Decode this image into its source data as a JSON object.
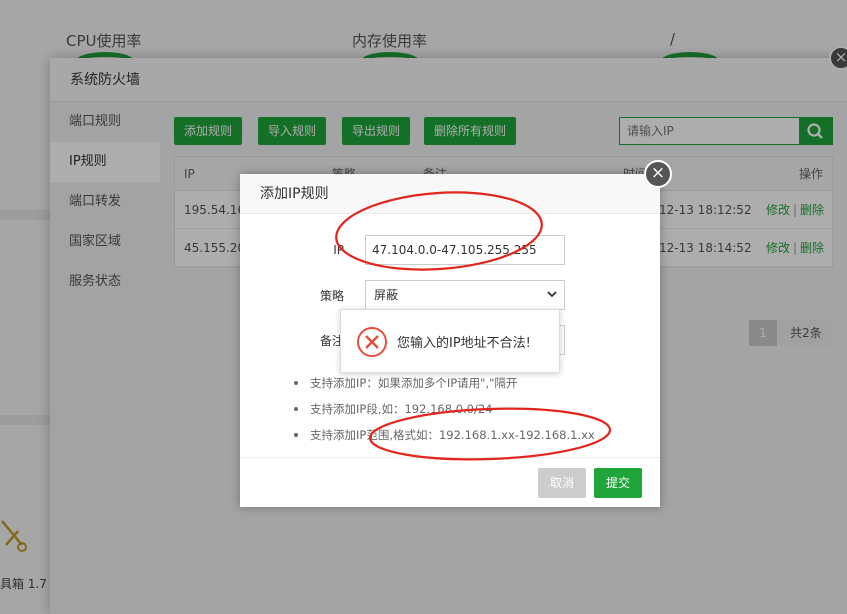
{
  "background": {
    "metrics": [
      "CPU使用率",
      "内存使用率",
      "/"
    ],
    "toolbox_label": "具箱 1.7"
  },
  "firewall": {
    "title": "系统防火墙",
    "sidebar": [
      {
        "label": "端口规则"
      },
      {
        "label": "IP规则"
      },
      {
        "label": "端口转发"
      },
      {
        "label": "国家区域"
      },
      {
        "label": "服务状态"
      }
    ],
    "toolbar": {
      "add": "添加规则",
      "import": "导入规则",
      "export": "导出规则",
      "delete_all": "删除所有规则",
      "search_placeholder": "请输入IP"
    },
    "table": {
      "headers": {
        "ip": "IP",
        "policy": "策略",
        "note": "备注",
        "time": "时间",
        "ops": "操作"
      },
      "rows": [
        {
          "ip": "195.54.16",
          "time": "12-13 18:12:52",
          "edit": "修改",
          "sep": "|",
          "del": "删除"
        },
        {
          "ip": "45.155.20",
          "time": "12-13 18:14:52",
          "edit": "修改",
          "sep": "|",
          "del": "删除"
        }
      ]
    },
    "pager": {
      "current": "1",
      "total": "共2条"
    }
  },
  "dialog": {
    "title": "添加IP规则",
    "ip_label": "IP",
    "ip_value": "47.104.0.0-47.105.255.255",
    "policy_label": "策略",
    "policy_value": "屏蔽",
    "note_label": "备注",
    "tips": [
      "支持添加IP：如果添加多个IP请用\",\"隔开",
      "支持添加IP段,如：192.168.0.0/24",
      "支持添加IP范围,格式如：192.168.1.xx-192.168.1.xx"
    ],
    "cancel": "取消",
    "submit": "提交"
  },
  "toast": {
    "message": "您输入的IP地址不合法!"
  },
  "colors": {
    "accent": "#20a53a",
    "error": "#e74c3c",
    "annotation": "#e3261c"
  },
  "icons": [
    "close-icon",
    "search-icon",
    "error-icon",
    "chevron-down-icon",
    "toolbox-icon"
  ]
}
